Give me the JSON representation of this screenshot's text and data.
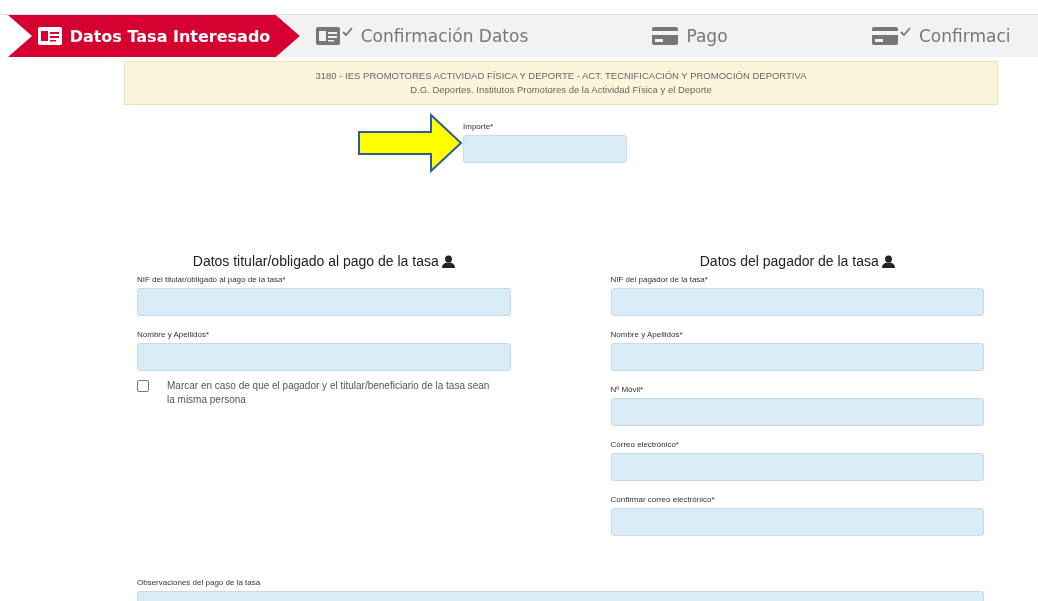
{
  "steps": [
    {
      "label": "Datos Tasa Interesado",
      "kind": "identity",
      "checked": false,
      "selected": true
    },
    {
      "label": "Confirmación Datos",
      "kind": "identity",
      "checked": true,
      "selected": false
    },
    {
      "label": "Pago",
      "kind": "payment",
      "checked": false,
      "selected": false
    },
    {
      "label": "Confirmaci",
      "kind": "payment",
      "checked": true,
      "selected": false
    }
  ],
  "info": {
    "line_1": "3180  -  IES PROMOTORES ACTIVIDAD FÍSICA Y DEPORTE  -  ACT. TECNIFICACIÓN Y PROMOCIÓN DEPORTIVA",
    "line_2": "D.G. Deportes. Institutos Promotores de la Actividad Física y el Deporte"
  },
  "amount": {
    "label": "Importe*"
  },
  "holder": {
    "title": "Datos titular/obligado al pago de la tasa",
    "fields": [
      {
        "label": "NIF del titular/obligado al pago de la tasa*"
      },
      {
        "label": "Nombre y Apellidos*"
      }
    ],
    "checkbox": {
      "label": "Marcar en caso de que el pagador y el titular/beneficiario de la tasa sean la misma persona",
      "checked": false
    }
  },
  "payer": {
    "title": "Datos del pagador de la tasa",
    "fields": [
      {
        "label": "NIF del pagador de la tasa*"
      },
      {
        "label": "Nombre y Apellidos*"
      },
      {
        "label": "Nº Móvil*"
      },
      {
        "label": "Correo electrónico*"
      },
      {
        "label": "Confirmar correo electrónico*"
      }
    ]
  },
  "observations": {
    "label": "Observaciones del pago de la tasa"
  }
}
